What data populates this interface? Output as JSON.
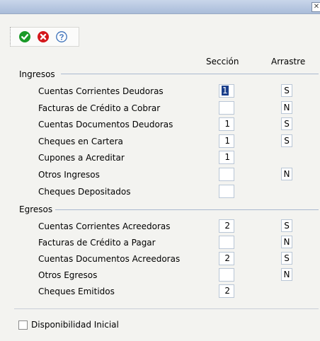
{
  "window": {
    "close_glyph": "✕"
  },
  "toolbar": {
    "buttons": [
      {
        "name": "accept-button",
        "icon": "check-icon",
        "color": "#1a9a28"
      },
      {
        "name": "cancel-button",
        "icon": "x-icon",
        "color": "#d4181c"
      },
      {
        "name": "help-button",
        "icon": "question-icon",
        "color": "#3a6fb8"
      }
    ]
  },
  "columns": {
    "seccion": "Sección",
    "arrastre": "Arrastre"
  },
  "ingresos": {
    "title": "Ingresos",
    "rows": [
      {
        "label": "Cuentas Corrientes Deudoras",
        "seccion": "1",
        "arrastre": "S"
      },
      {
        "label": "Facturas de Crédito a Cobrar",
        "seccion": "",
        "arrastre": "N"
      },
      {
        "label": "Cuentas Documentos Deudoras",
        "seccion": "1",
        "arrastre": "S"
      },
      {
        "label": "Cheques en Cartera",
        "seccion": "1",
        "arrastre": "S"
      },
      {
        "label": "Cupones a Acreditar",
        "seccion": "1",
        "arrastre": ""
      },
      {
        "label": "Otros Ingresos",
        "seccion": "",
        "arrastre": "N"
      },
      {
        "label": "Cheques Depositados",
        "seccion": "",
        "arrastre": ""
      }
    ]
  },
  "egresos": {
    "title": "Egresos",
    "rows": [
      {
        "label": "Cuentas Corrientes Acreedoras",
        "seccion": "2",
        "arrastre": "S"
      },
      {
        "label": "Facturas de Crédito a Pagar",
        "seccion": "",
        "arrastre": "N"
      },
      {
        "label": "Cuentas Documentos Acreedoras",
        "seccion": "2",
        "arrastre": "S"
      },
      {
        "label": "Otros Egresos",
        "seccion": "",
        "arrastre": "N"
      },
      {
        "label": "Cheques Emitidos",
        "seccion": "2",
        "arrastre": ""
      }
    ]
  },
  "footer": {
    "checkbox_label": "Disponibilidad Inicial",
    "checked": false
  }
}
